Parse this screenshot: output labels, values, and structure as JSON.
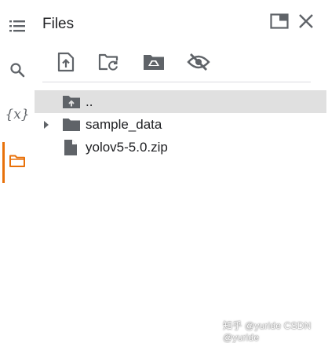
{
  "sidebar": {
    "items": [
      {
        "name": "toc-icon"
      },
      {
        "name": "search-icon"
      },
      {
        "name": "variables-icon",
        "label": "{x}"
      },
      {
        "name": "folder-icon",
        "active": true
      }
    ]
  },
  "panel": {
    "title": "Files"
  },
  "toolbar": {
    "buttons": [
      "upload-file-icon",
      "refresh-folder-icon",
      "mount-drive-icon",
      "hide-files-icon"
    ]
  },
  "files": [
    {
      "name": "..",
      "type": "parent",
      "selected": true
    },
    {
      "name": "sample_data",
      "type": "folder",
      "expandable": true
    },
    {
      "name": "yolov5-5.0.zip",
      "type": "file"
    }
  ],
  "watermark": "知乎 @yuride CSDN @yuride",
  "colors": {
    "accent": "#e8710a",
    "icon": "#5f6368",
    "selected_row": "#e0e0e0"
  }
}
